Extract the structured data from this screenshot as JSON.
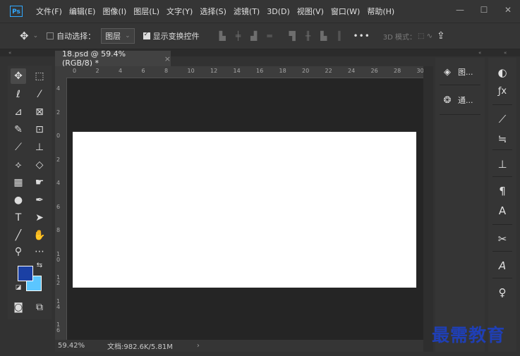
{
  "menubar": {
    "logo": "Ps",
    "items": [
      "文件(F)",
      "编辑(E)",
      "图像(I)",
      "图层(L)",
      "文字(Y)",
      "选择(S)",
      "滤镜(T)",
      "3D(D)",
      "视图(V)",
      "窗口(W)",
      "帮助(H)"
    ],
    "window_controls": [
      "minimize-icon",
      "restore-icon",
      "close-icon"
    ]
  },
  "options": {
    "auto_select_label": "自动选择：",
    "auto_select_checked": false,
    "target_select": "图层",
    "show_transform_label": "显示变换控件",
    "show_transform_checked": true,
    "more": "•••",
    "mode_3d": "3D 模式："
  },
  "document": {
    "tab_title": "18.psd @ 59.4%(RGB/8) *",
    "canvas_color": "#ffffff",
    "pasteboard_color": "#252525"
  },
  "rulers": {
    "horizontal": [
      "0",
      "2",
      "4",
      "6",
      "8",
      "10",
      "12",
      "14",
      "16",
      "18",
      "20",
      "22",
      "24",
      "26",
      "28",
      "30"
    ],
    "vertical": [
      "4",
      "2",
      "0",
      "2",
      "4",
      "6",
      "8",
      "1 0",
      "1 2",
      "1 4",
      "1 6"
    ]
  },
  "status": {
    "zoom": "59.42%",
    "doc_info": "文档:982.6K/5.81M",
    "arrow": "›"
  },
  "colors": {
    "foreground": "#1b40a4",
    "background": "#5bc6ff"
  },
  "panels": {
    "left": [
      {
        "icon": "layers-icon",
        "label": "图..."
      },
      {
        "icon": "channels-icon",
        "label": "通..."
      }
    ]
  },
  "watermark": "最需教育"
}
